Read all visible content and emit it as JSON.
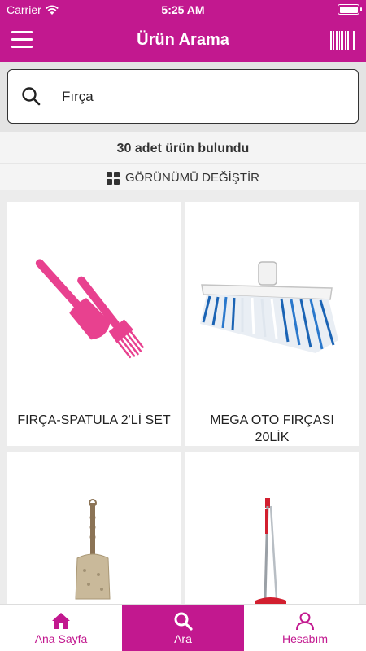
{
  "status_bar": {
    "carrier": "Carrier",
    "time": "5:25 AM"
  },
  "nav": {
    "title": "Ürün Arama"
  },
  "search": {
    "value": "Fırça"
  },
  "results": {
    "count_text": "30 adet ürün bulundu",
    "view_toggle_label": "GÖRÜNÜMÜ DEĞİŞTİR"
  },
  "products": [
    {
      "name": "FIRÇA-SPATULA 2'Lİ SET"
    },
    {
      "name": "MEGA OTO FIRÇASI 20LİK"
    },
    {
      "name": ""
    },
    {
      "name": ""
    }
  ],
  "tabs": [
    {
      "label": "Ana Sayfa",
      "icon": "home-icon"
    },
    {
      "label": "Ara",
      "icon": "search-icon"
    },
    {
      "label": "Hesabım",
      "icon": "user-icon"
    }
  ],
  "colors": {
    "brand": "#c2188f",
    "spatula": "#e8418f",
    "brush_blue": "#1a63b4"
  }
}
